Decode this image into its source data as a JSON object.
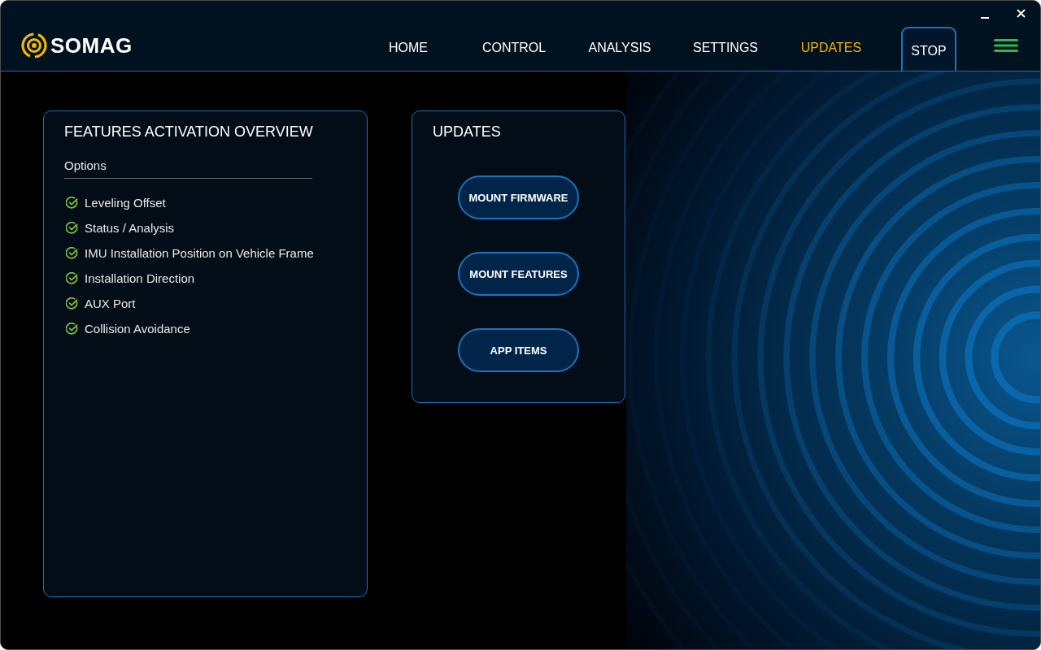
{
  "header": {
    "logo_text": "SOMAG",
    "nav": [
      {
        "label": "HOME",
        "selected": false
      },
      {
        "label": "CONTROL",
        "selected": false
      },
      {
        "label": "ANALYSIS",
        "selected": false
      },
      {
        "label": "SETTINGS",
        "selected": false
      },
      {
        "label": "UPDATES",
        "selected": true
      }
    ],
    "stop_button": "STOP"
  },
  "features_card": {
    "title": "FEATURES ACTIVATION OVERVIEW",
    "section_label": "Options",
    "options": [
      {
        "label": "Leveling Offset",
        "checked": true
      },
      {
        "label": "Status / Analysis",
        "checked": true
      },
      {
        "label": "IMU Installation Position on Vehicle Frame",
        "checked": true
      },
      {
        "label": "Installation Direction",
        "checked": true
      },
      {
        "label": "AUX Port",
        "checked": true
      },
      {
        "label": "Collision Avoidance",
        "checked": true
      }
    ]
  },
  "updates_card": {
    "title": "UPDATES",
    "buttons": [
      "MOUNT FIRMWARE",
      "MOUNT FEATURES",
      "APP ITEMS"
    ]
  }
}
